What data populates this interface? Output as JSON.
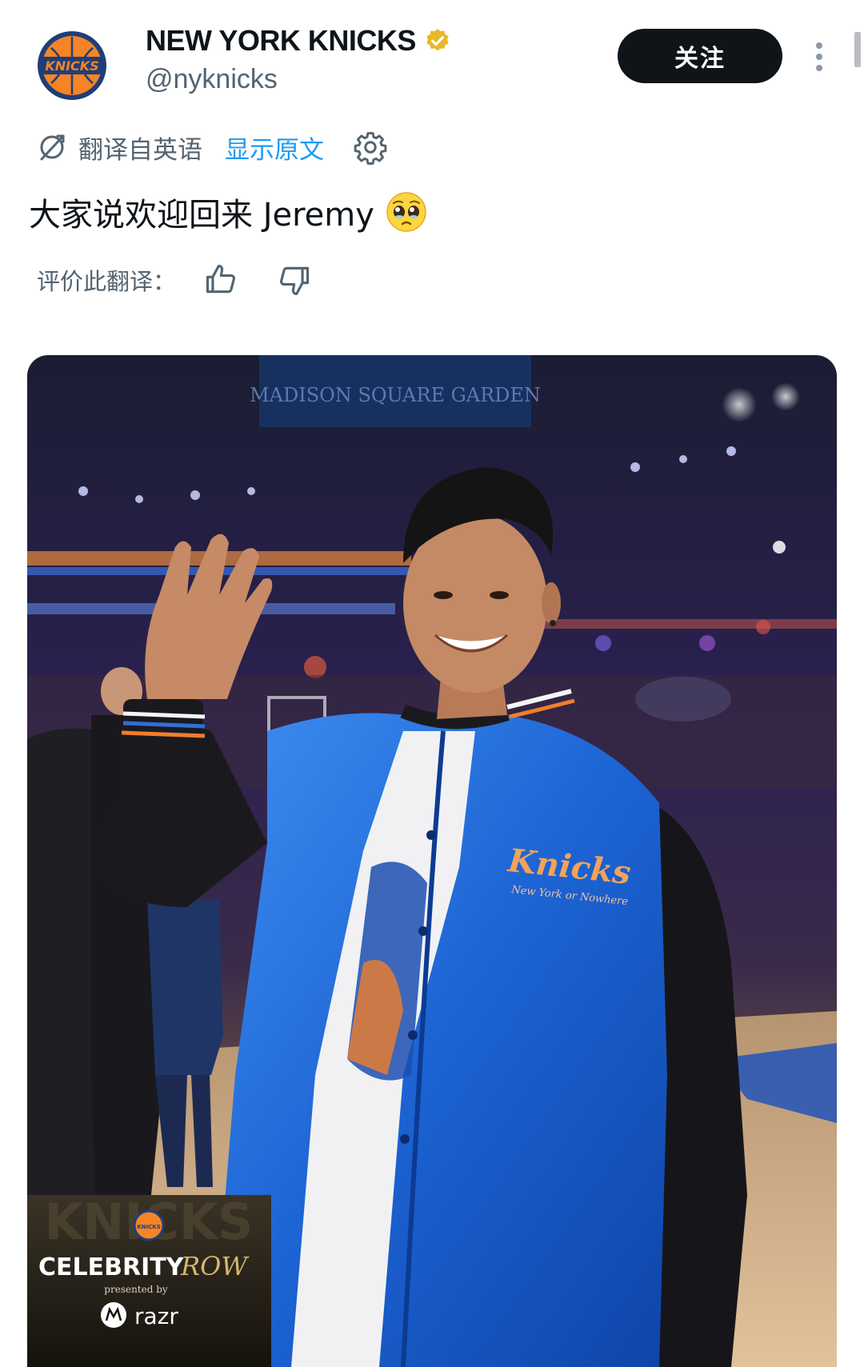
{
  "account": {
    "display_name": "NEW YORK KNICKS",
    "handle": "@nyknicks",
    "avatar_text": "KNICKS",
    "verified": true
  },
  "follow_button": {
    "label": "关注"
  },
  "translation": {
    "translated_from": "翻译自英语",
    "show_original": "显示原文"
  },
  "tweet": {
    "text": "大家说欢迎回来 Jeremy",
    "emoji": "pleading-face"
  },
  "rate_translation": {
    "label": "评价此翻译："
  },
  "photo": {
    "arena_banner": "MADISON SQUARE GARDEN",
    "jacket_brand": "Knicks",
    "jacket_tagline": "New York or Nowhere",
    "overlay": {
      "logo_text": "KNICKS",
      "title_1": "CELEBRITY",
      "title_2": "ROW",
      "presented_by": "presented by",
      "sponsor": "razr"
    }
  },
  "colors": {
    "accent_blue": "#1d9bf0",
    "verified_gold": "#e8b829",
    "knicks_blue": "#006bb6",
    "knicks_orange": "#f58426"
  }
}
